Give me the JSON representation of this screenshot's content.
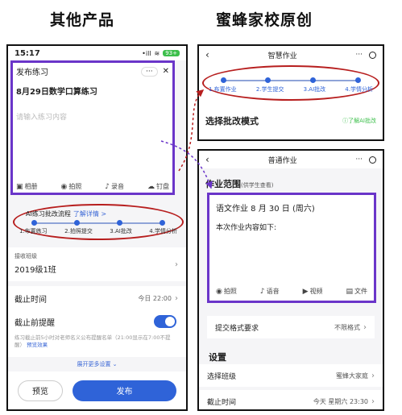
{
  "headings": {
    "left": "其他产品",
    "right": "蜜蜂家校原创"
  },
  "left_phone": {
    "status": {
      "time": "15:17",
      "signal": "•ill",
      "wifi": "≋",
      "battery": "93+"
    },
    "compose": {
      "title": "发布练习",
      "menu_dots": "···",
      "menu_ring": "◦",
      "close": "✕",
      "subject": "8月29日数学口算练习",
      "placeholder": "请输入练习内容",
      "attachments": [
        "相册",
        "拍照",
        "录音",
        "钉盘"
      ]
    },
    "flow": {
      "title": "AI练习批改流程",
      "link": "了解详情 >",
      "steps": [
        "1.布置练习",
        "2.拍照提交",
        "3.AI批改",
        "4.学情分析"
      ]
    },
    "class": {
      "label": "接收班级",
      "value": "2019级1班",
      "chevron": "›"
    },
    "deadline": {
      "label": "截止时间",
      "value": "今日 22:00",
      "chevron": "›"
    },
    "remind": {
      "label": "截止前提醒",
      "on": true,
      "note": "练习截止前5小时对老师名义公布提醒名单（21:00显示在7:00不提醒）",
      "note_link": "预览效果"
    },
    "more": "展开更多设置 ⌄",
    "buttons": {
      "preview": "预览",
      "publish": "发布"
    }
  },
  "right_top_phone": {
    "nav": {
      "back": "‹",
      "title": "智慧作业",
      "dots": "···",
      "dash": "—"
    },
    "flow": {
      "steps": [
        "1.布置作业",
        "2.学生提交",
        "3.AI批改",
        "4.学情分析"
      ]
    },
    "mode": {
      "title": "选择批改模式",
      "link": "ⓘ了解AI批改"
    }
  },
  "right_bottom_phone": {
    "nav": {
      "back": "‹",
      "title": "普通作业",
      "dots": "···",
      "dash": "—"
    },
    "scope": {
      "title": "作业范围",
      "note": "(供学生查看)"
    },
    "homework": {
      "title": "语文作业 8 月 30 日 (周六)",
      "body": "本次作业内容如下:",
      "attachments": [
        "拍照",
        "语音",
        "视频",
        "文件"
      ]
    },
    "submit": {
      "label": "提交格式要求",
      "value": "不限格式",
      "chevron": "›"
    },
    "settings_title": "设置",
    "class": {
      "label": "选择班级",
      "value": "蜜蜂大家庭",
      "chevron": "›"
    },
    "deadline": {
      "label": "截止时间",
      "value": "今天 星期六 23:30",
      "chevron": "›"
    }
  },
  "colors": {
    "accent": "#2f63d8",
    "purple_frame": "#6a35c9",
    "red_ellipse": "#b71e1e",
    "green": "#3cbf4b"
  }
}
